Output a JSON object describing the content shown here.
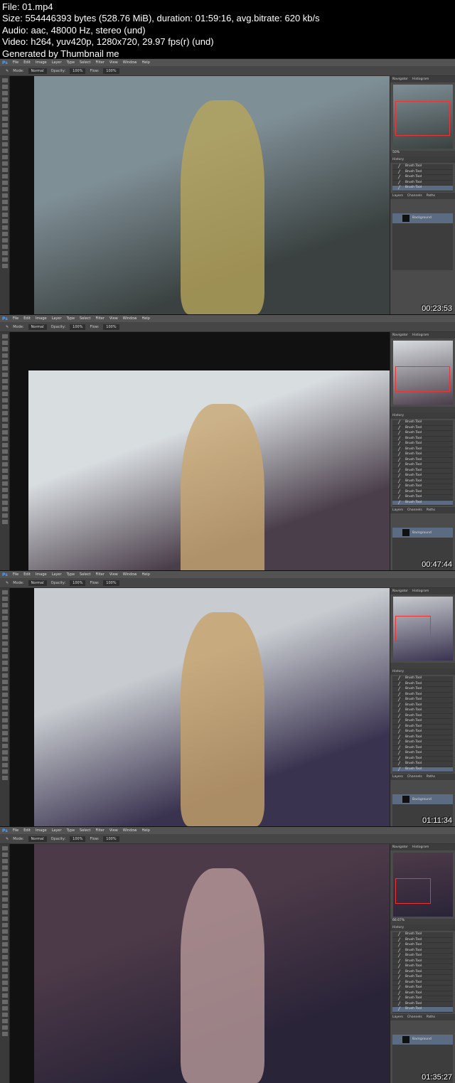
{
  "header": {
    "lines": [
      "File: 01.mp4",
      "Size: 554446393 bytes (528.76 MiB), duration: 01:59:16, avg.bitrate: 620 kb/s",
      "Audio: aac, 48000 Hz, stereo (und)",
      "Video: h264, yuv420p, 1280x720, 29.97 fps(r) (und)",
      "Generated by Thumbnail me"
    ]
  },
  "app": {
    "logo": "Ps",
    "menu": [
      "File",
      "Edit",
      "Image",
      "Layer",
      "Type",
      "Select",
      "Filter",
      "View",
      "Window",
      "Help"
    ],
    "options": {
      "mode_label": "Mode:",
      "mode": "Normal",
      "opacity_label": "Opacity:",
      "opacity": "100%",
      "flow_label": "Flow:",
      "flow": "100%"
    },
    "panel_tabs": [
      "Navigator",
      "Histogram"
    ],
    "history_title": "History",
    "layer_tabs": [
      "Layers",
      "Channels",
      "Paths"
    ],
    "layer_name": "Background",
    "history_item": "Brush Tool"
  },
  "frames": [
    {
      "timestamp": "00:23:53",
      "zoom": "50%",
      "history_count": 5,
      "colors": [
        "#7f8f96",
        "#3a4140",
        "#b7a45a"
      ]
    },
    {
      "timestamp": "00:47:44",
      "zoom": "",
      "history_count": 16,
      "colors": [
        "#d8dde0",
        "#4a3e4a",
        "#c9a872"
      ]
    },
    {
      "timestamp": "01:11:34",
      "zoom": "",
      "history_count": 18,
      "colors": [
        "#c8ccd0",
        "#3a3350",
        "#c7a26a"
      ]
    },
    {
      "timestamp": "01:35:27",
      "zoom": "66.67%",
      "history_count": 15,
      "colors": [
        "#4d3a48",
        "#2a2438",
        "#b89a9a"
      ]
    }
  ]
}
